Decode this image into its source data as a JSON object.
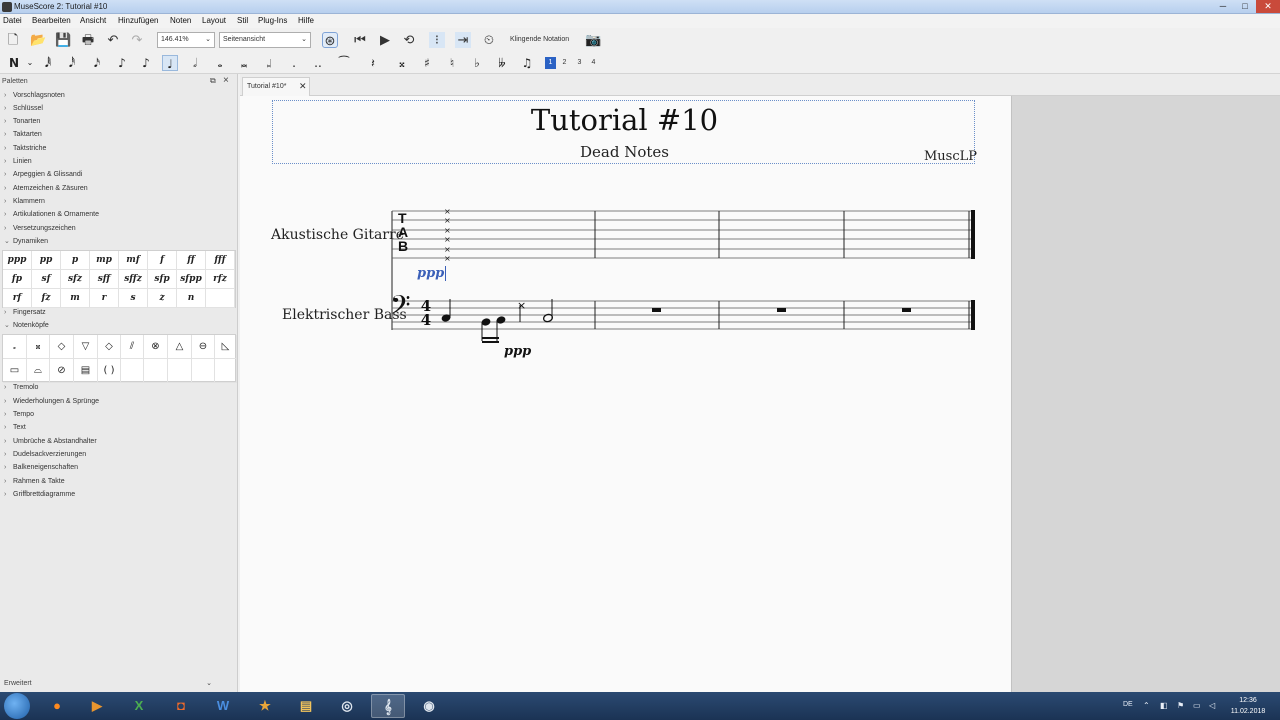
{
  "window": {
    "title": "MuseScore 2: Tutorial #10"
  },
  "menu": [
    "Datei",
    "Bearbeiten",
    "Ansicht",
    "Hinzufügen",
    "Noten",
    "Layout",
    "Stil",
    "Plug-Ins",
    "Hilfe"
  ],
  "toolbar": {
    "zoom_value": "146.41%",
    "view_mode": "Seitenansicht",
    "concert_pitch_label": "Klingende Notation"
  },
  "note_input": {
    "duration_selected": "quarter",
    "voices": [
      "1",
      "2",
      "3",
      "4"
    ],
    "active_voice": "1"
  },
  "palette": {
    "header": "Paletten",
    "sections_top": [
      "Vorschlagsnoten",
      "Schlüssel",
      "Tonarten",
      "Taktarten",
      "Taktstriche",
      "Linien",
      "Arpeggien & Glissandi",
      "Atemzeichen & Zäsuren",
      "Klammern",
      "Artikulationen & Ornamente",
      "Versetzungszeichen"
    ],
    "dynamics_label": "Dynamiken",
    "dynamics": [
      "ppp",
      "pp",
      "p",
      "mp",
      "mf",
      "f",
      "ff",
      "fff",
      "fp",
      "sf",
      "sfz",
      "sff",
      "sffz",
      "sfp",
      "sfpp",
      "rfz",
      "rf",
      "fz",
      "m",
      "r",
      "s",
      "z",
      "n"
    ],
    "fingering_label": "Fingersatz",
    "noteheads_label": "Notenköpfe",
    "sections_bottom": [
      "Tremolo",
      "Wiederholungen & Sprünge",
      "Tempo",
      "Text",
      "Umbrüche & Abstandhalter",
      "Dudelsackverzierungen",
      "Balkeneigenschaften",
      "Rahmen & Takte",
      "Griffbrettdiagramme"
    ],
    "workspace": "Erweitert"
  },
  "tab": {
    "label": "Tutorial #10*"
  },
  "score": {
    "title": "Tutorial #10",
    "subtitle": "Dead Notes",
    "composer": "MuscLP",
    "instruments": [
      "Akustische Gitarre",
      "Elektrischer Bass"
    ],
    "tab_clef": [
      "T",
      "A",
      "B"
    ],
    "time_signature": [
      "4",
      "4"
    ],
    "guitar_dynamic": "ppp",
    "bass_dynamic": "ppp"
  },
  "taskbar": {
    "language": "DE",
    "time": "12:36",
    "date": "11.02.2018"
  },
  "colors": {
    "accent": "#2b62c4",
    "dynamic_selected": "#3a5fb8",
    "taskbar": "#1f3a5f"
  }
}
